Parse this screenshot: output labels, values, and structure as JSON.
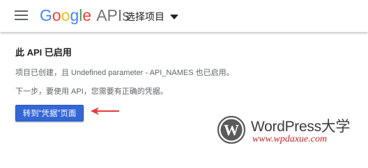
{
  "header": {
    "logo": {
      "letters": [
        {
          "char": "G",
          "color": "#4285F4"
        },
        {
          "char": "o",
          "color": "#EA4335"
        },
        {
          "char": "o",
          "color": "#FBBC05"
        },
        {
          "char": "g",
          "color": "#4285F4"
        },
        {
          "char": "l",
          "color": "#34A853"
        },
        {
          "char": "e",
          "color": "#EA4335"
        }
      ],
      "suffix": "APIs"
    },
    "project_select_label": "选择项目",
    "menu_icon": "hamburger-menu-icon",
    "dropdown_icon": "caret-down-icon"
  },
  "main": {
    "title": "此 API 已启用",
    "message": "项目已创建，且 Undefined parameter - API_NAMES 也已启用。",
    "next_step": "下一步，要使用 API，您需要有正确的凭据。",
    "button_label": "转到“凭据”页面"
  },
  "annotation": {
    "icon": "red-arrow-icon",
    "color": "#e53935"
  },
  "watermark": {
    "icon": "wordpress-logo-icon",
    "title": "WordPress大学",
    "url": "www.wpdaxue.com"
  },
  "colors": {
    "primary_button": "#3367d6",
    "logo_gray": "#757575"
  }
}
